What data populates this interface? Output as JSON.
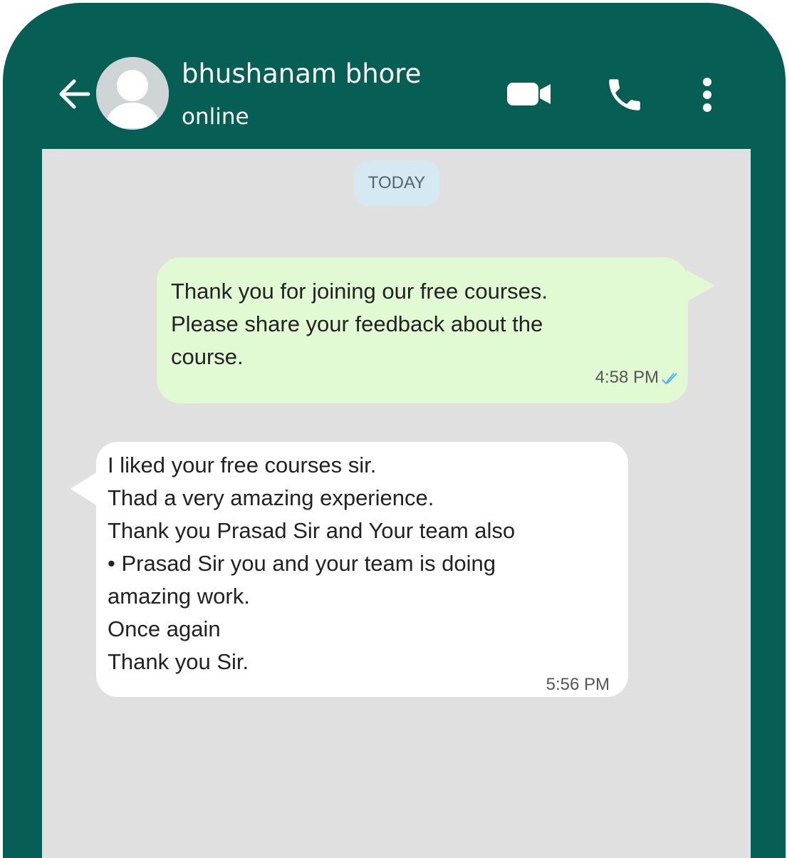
{
  "header": {
    "contact_name": "bhushanam bhore",
    "status": "online",
    "icons": {
      "back": "arrow-left-icon",
      "avatar": "default-avatar-icon",
      "video": "video-camera-icon",
      "call": "phone-icon",
      "menu": "more-vertical-icon"
    }
  },
  "chat": {
    "date_label": "TODAY",
    "messages": [
      {
        "direction": "outgoing",
        "lines": [
          "Thank you for joining our free courses.",
          "Please share your feedback about the",
          "course."
        ],
        "time": "4:58 PM",
        "status_icon": "double-check-icon"
      },
      {
        "direction": "incoming",
        "lines": [
          "I liked your free courses sir.",
          "Thad a very amazing experience.",
          "Thank you Prasad Sir and Your team also",
          "• Prasad Sir you and your team is doing",
          "amazing work.",
          "Once again",
          "Thank you Sir."
        ],
        "time": "5:56 PM"
      }
    ]
  },
  "colors": {
    "header_bg": "#075e54",
    "chat_bg": "#e0e0e0",
    "outgoing_bubble": "#e2fad4",
    "incoming_bubble": "#ffffff",
    "date_pill": "#d5e9f3",
    "read_ticks": "#4fb6ec"
  }
}
